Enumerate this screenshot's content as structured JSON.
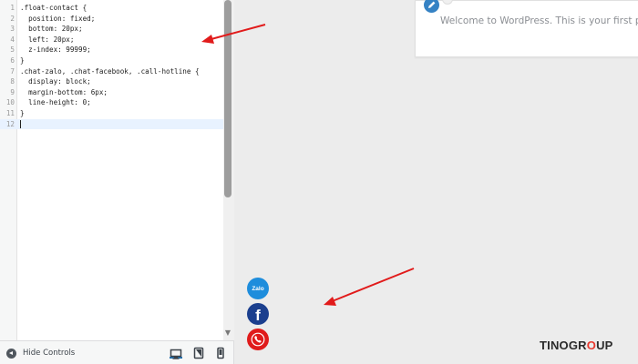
{
  "editor": {
    "lines": [
      {
        "n": "1",
        "text": ".float-contact {"
      },
      {
        "n": "2",
        "text": "  position: fixed;"
      },
      {
        "n": "3",
        "text": "  bottom: 20px;"
      },
      {
        "n": "4",
        "text": "  left: 20px;"
      },
      {
        "n": "5",
        "text": "  z-index: 99999;"
      },
      {
        "n": "6",
        "text": "}"
      },
      {
        "n": "7",
        "text": ".chat-zalo, .chat-facebook, .call-hotline {"
      },
      {
        "n": "8",
        "text": "  display: block;"
      },
      {
        "n": "9",
        "text": "  margin-bottom: 6px;"
      },
      {
        "n": "10",
        "text": "  line-height: 0;"
      },
      {
        "n": "11",
        "text": "}"
      },
      {
        "n": "12",
        "text": ""
      }
    ],
    "scroll_down_glyph": "▼"
  },
  "controls": {
    "hide_label": "Hide Controls"
  },
  "preview": {
    "comment_text": "Welcome to WordPress. This is your first post",
    "zalo_label": "Zalo",
    "facebook_label": "f"
  },
  "logo": {
    "part1": "TINO",
    "part2": "GR",
    "part3": "O",
    "part4": "UP"
  },
  "colors": {
    "accent": "#2271b1",
    "zalo": "#1e8ddc",
    "facebook": "#1b3f8e",
    "hotline": "#e01b1b",
    "arrow": "#e11b1b"
  }
}
